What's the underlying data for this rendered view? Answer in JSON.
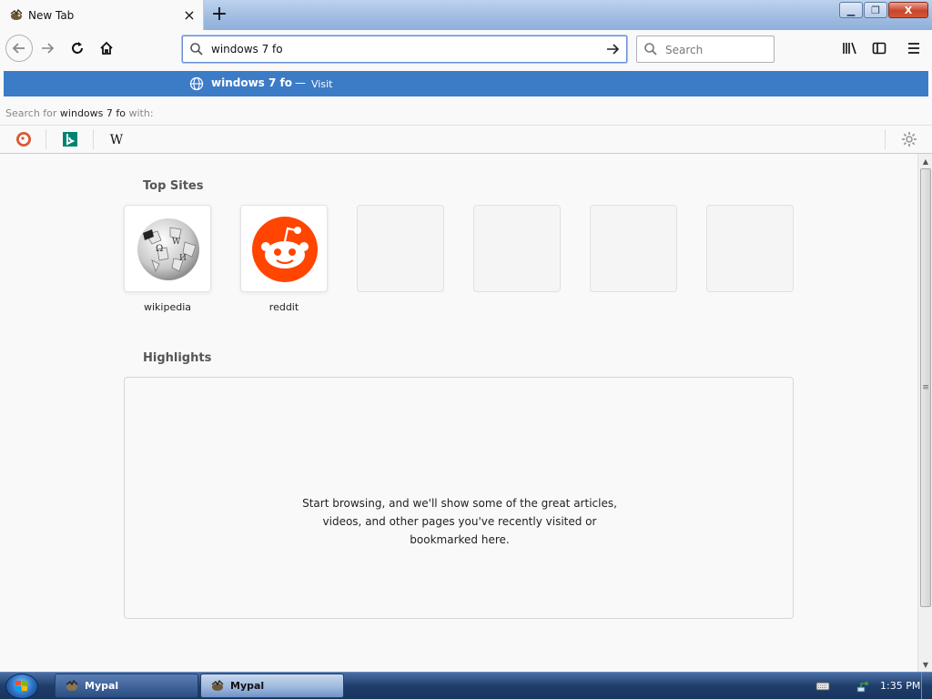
{
  "window": {
    "tab_title": "New Tab",
    "tab_close": "×",
    "new_tab": "+",
    "min_label": "▁",
    "max_label": "❐",
    "close_label": "X"
  },
  "toolbar": {
    "url_value": "windows 7 fo",
    "search_placeholder": "Search"
  },
  "dropdown": {
    "suggestion_text": "windows 7 fo",
    "suggestion_sep": "—",
    "suggestion_action": "Visit",
    "search_for_prefix": "Search for",
    "search_for_query": "windows 7 fo",
    "search_for_suffix": "with:",
    "engines": [
      "duckduckgo",
      "bing",
      "wikipedia"
    ]
  },
  "top_sites": {
    "title": "Top Sites",
    "tiles": [
      {
        "label": "wikipedia",
        "icon": "wikipedia-globe-icon"
      },
      {
        "label": "reddit",
        "icon": "reddit-icon"
      },
      {
        "label": "",
        "icon": ""
      },
      {
        "label": "",
        "icon": ""
      },
      {
        "label": "",
        "icon": ""
      },
      {
        "label": "",
        "icon": ""
      }
    ]
  },
  "highlights": {
    "title": "Highlights",
    "empty_message": "Start browsing, and we'll show some of the great articles, videos, and other pages you've recently visited or bookmarked here."
  },
  "taskbar": {
    "items": [
      {
        "label": "Mypal",
        "state": "inactive"
      },
      {
        "label": "Mypal",
        "state": "active"
      }
    ],
    "clock": "1:35 PM"
  },
  "colors": {
    "accent": "#3c7bc6",
    "reddit": "#ff4500"
  }
}
